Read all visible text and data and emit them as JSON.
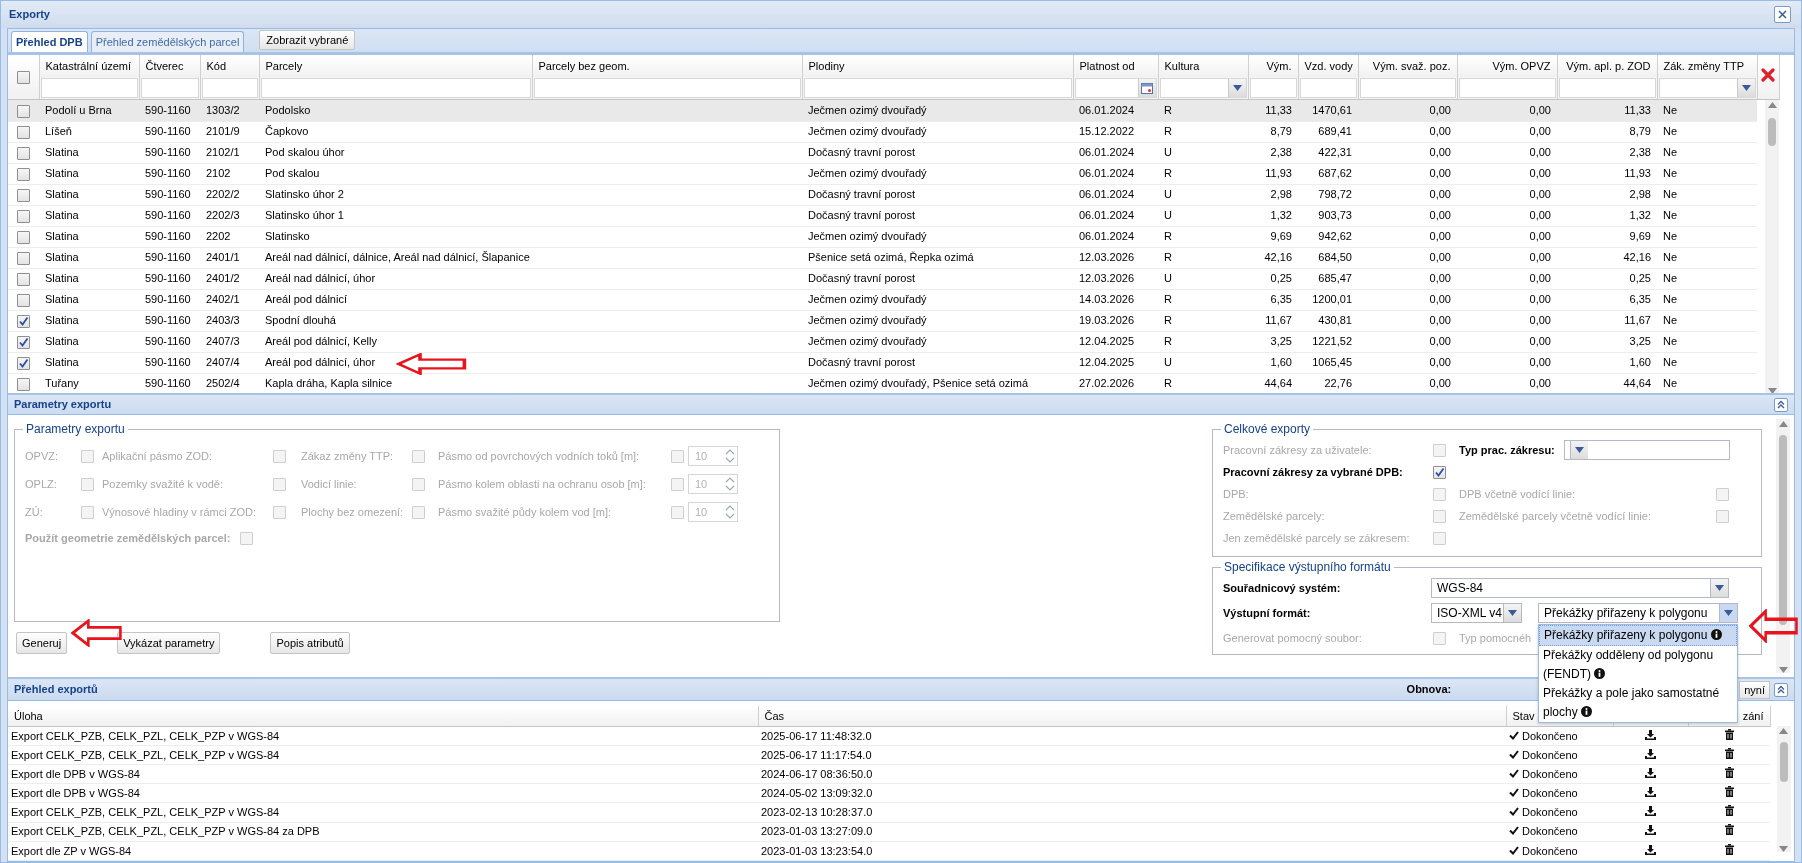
{
  "window": {
    "title": "Exporty"
  },
  "tabs": [
    {
      "label": "Přehled DPB",
      "selected": true
    },
    {
      "label": "Přehled zemědělských parcel",
      "selected": false
    }
  ],
  "show_selected_button": "Zobrazit vybrané",
  "parcels_grid": {
    "select_all": {
      "checked": false
    },
    "columns": [
      {
        "label": "Katastrální území",
        "kind": "text"
      },
      {
        "label": "Čtverec",
        "kind": "text"
      },
      {
        "label": "Kód",
        "kind": "text"
      },
      {
        "label": "Parcely",
        "kind": "text"
      },
      {
        "label": "Parcely bez geom.",
        "kind": "text"
      },
      {
        "label": "Plodiny",
        "kind": "text"
      },
      {
        "label": "Platnost od",
        "kind": "date"
      },
      {
        "label": "Kultura",
        "kind": "select"
      },
      {
        "label": "Vým.",
        "kind": "number"
      },
      {
        "label": "Vzd. vody",
        "kind": "number"
      },
      {
        "label": "Vým. svaž. poz.",
        "kind": "number"
      },
      {
        "label": "Vým. OPVZ",
        "kind": "number"
      },
      {
        "label": "Vým. apl. p. ZOD",
        "kind": "number"
      },
      {
        "label": "Zák. změny TTP",
        "kind": "select"
      }
    ],
    "rows": [
      {
        "selected": true,
        "checked": false,
        "cells": [
          "Podolí u Brna",
          "590-1160",
          "1303/2",
          "Podolsko",
          "",
          "Ječmen ozimý dvouřadý",
          "06.01.2024",
          "R",
          "11,33",
          "1470,61",
          "0,00",
          "0,00",
          "11,33",
          "Ne"
        ]
      },
      {
        "selected": false,
        "checked": false,
        "cells": [
          "Líšeň",
          "590-1160",
          "2101/9",
          "Čapkovo",
          "",
          "Ječmen ozimý dvouřadý",
          "15.12.2022",
          "R",
          "8,79",
          "689,41",
          "0,00",
          "0,00",
          "8,79",
          "Ne"
        ]
      },
      {
        "selected": false,
        "checked": false,
        "cells": [
          "Slatina",
          "590-1160",
          "2102/1",
          "Pod skalou úhor",
          "",
          "Dočasný travní porost",
          "06.01.2024",
          "U",
          "2,38",
          "422,31",
          "0,00",
          "0,00",
          "2,38",
          "Ne"
        ]
      },
      {
        "selected": false,
        "checked": false,
        "cells": [
          "Slatina",
          "590-1160",
          "2102",
          "Pod skalou",
          "",
          "Ječmen ozimý dvouřadý",
          "06.01.2024",
          "R",
          "11,93",
          "687,62",
          "0,00",
          "0,00",
          "11,93",
          "Ne"
        ]
      },
      {
        "selected": false,
        "checked": false,
        "cells": [
          "Slatina",
          "590-1160",
          "2202/2",
          "Slatinsko úhor 2",
          "",
          "Dočasný travní porost",
          "06.01.2024",
          "U",
          "2,98",
          "798,72",
          "0,00",
          "0,00",
          "2,98",
          "Ne"
        ]
      },
      {
        "selected": false,
        "checked": false,
        "cells": [
          "Slatina",
          "590-1160",
          "2202/3",
          "Slatinsko úhor 1",
          "",
          "Dočasný travní porost",
          "06.01.2024",
          "U",
          "1,32",
          "903,73",
          "0,00",
          "0,00",
          "1,32",
          "Ne"
        ]
      },
      {
        "selected": false,
        "checked": false,
        "cells": [
          "Slatina",
          "590-1160",
          "2202",
          "Slatinsko",
          "",
          "Ječmen ozimý dvouřadý",
          "06.01.2024",
          "R",
          "9,69",
          "942,62",
          "0,00",
          "0,00",
          "9,69",
          "Ne"
        ]
      },
      {
        "selected": false,
        "checked": false,
        "cells": [
          "Slatina",
          "590-1160",
          "2401/1",
          "Areál nad dálnicí, dálnice, Areál nad dálnicí, Šlapanice",
          "",
          "Pšenice setá ozimá, Řepka ozimá",
          "12.03.2026",
          "R",
          "42,16",
          "684,50",
          "0,00",
          "0,00",
          "42,16",
          "Ne"
        ]
      },
      {
        "selected": false,
        "checked": false,
        "cells": [
          "Slatina",
          "590-1160",
          "2401/2",
          "Areál nad dálnicí, úhor",
          "",
          "Dočasný travní porost",
          "12.03.2026",
          "U",
          "0,25",
          "685,47",
          "0,00",
          "0,00",
          "0,25",
          "Ne"
        ]
      },
      {
        "selected": false,
        "checked": false,
        "cells": [
          "Slatina",
          "590-1160",
          "2402/1",
          "Areál pod dálnicí",
          "",
          "Ječmen ozimý dvouřadý",
          "14.03.2026",
          "R",
          "6,35",
          "1200,01",
          "0,00",
          "0,00",
          "6,35",
          "Ne"
        ]
      },
      {
        "selected": false,
        "checked": true,
        "cells": [
          "Slatina",
          "590-1160",
          "2403/3",
          "Spodní dlouhá",
          "",
          "Ječmen ozimý dvouřadý",
          "19.03.2026",
          "R",
          "11,67",
          "430,81",
          "0,00",
          "0,00",
          "11,67",
          "Ne"
        ]
      },
      {
        "selected": false,
        "checked": true,
        "cells": [
          "Slatina",
          "590-1160",
          "2407/3",
          "Areál pod dálnicí, Kelly",
          "",
          "Ječmen ozimý dvouřadý",
          "12.04.2025",
          "R",
          "3,25",
          "1221,52",
          "0,00",
          "0,00",
          "3,25",
          "Ne"
        ]
      },
      {
        "selected": false,
        "checked": true,
        "cells": [
          "Slatina",
          "590-1160",
          "2407/4",
          "Areál pod dálnicí, úhor",
          "",
          "Dočasný travní porost",
          "12.04.2025",
          "U",
          "1,60",
          "1065,45",
          "0,00",
          "0,00",
          "1,60",
          "Ne"
        ]
      },
      {
        "selected": false,
        "checked": false,
        "cells": [
          "Tuřany",
          "590-1160",
          "2502/4",
          "Kapla dráha, Kapla silnice",
          "",
          "Ječmen ozimý dvouřadý, Pšenice setá ozimá",
          "27.02.2026",
          "R",
          "44,64",
          "22,76",
          "0,00",
          "0,00",
          "44,64",
          "Ne"
        ]
      }
    ]
  },
  "export_params": {
    "title": "Parametry exportu",
    "legend": "Parametry exportu",
    "rows": [
      [
        {
          "label": "OPVZ:",
          "checked": false,
          "disabled": true
        },
        {
          "label": "Aplikační pásmo ZOD:",
          "checked": false,
          "disabled": true
        },
        {
          "label": "Zákaz změny TTP:",
          "checked": false,
          "disabled": true
        },
        {
          "label": "Pásmo od povrchových vodních toků [m]:",
          "checked": false,
          "disabled": true,
          "value": "10"
        }
      ],
      [
        {
          "label": "OPLZ:",
          "checked": false,
          "disabled": true
        },
        {
          "label": "Pozemky svažité k vodě:",
          "checked": false,
          "disabled": true
        },
        {
          "label": "Vodicí linie:",
          "checked": false,
          "disabled": true
        },
        {
          "label": "Pásmo kolem oblasti na ochranu osob [m]:",
          "checked": false,
          "disabled": true,
          "value": "10"
        }
      ],
      [
        {
          "label": "ZÚ:",
          "checked": false,
          "disabled": true
        },
        {
          "label": "Výnosové hladiny v rámci ZOD:",
          "checked": false,
          "disabled": true
        },
        {
          "label": "Plochy bez omezení:",
          "checked": false,
          "disabled": true
        },
        {
          "label": "Pásmo svažité půdy kolem vod [m]:",
          "checked": false,
          "disabled": true,
          "value": "10"
        }
      ]
    ],
    "geometry": {
      "label": "Použít geometrie zemědělských parcel:",
      "checked": false,
      "disabled": true
    },
    "buttons": [
      "Generuj",
      "Vykázat parametry",
      "Popis atributů"
    ]
  },
  "total_exports": {
    "legend": "Celkové exporty",
    "rows": [
      [
        {
          "kind": "checkbox",
          "label": "Pracovní zákresy za uživatele:",
          "checked": false,
          "disabled": true
        },
        {
          "kind": "select",
          "label": "Typ prac. zákresu:",
          "disabled": false
        }
      ],
      [
        {
          "kind": "checkbox",
          "label": "Pracovní zákresy za vybrané DPB:",
          "checked": true,
          "disabled": false
        }
      ],
      [
        {
          "kind": "checkbox",
          "label": "DPB:",
          "checked": false,
          "disabled": true
        },
        {
          "kind": "checkbox",
          "label": "DPB včetně vodící linie:",
          "checked": false,
          "disabled": true
        }
      ],
      [
        {
          "kind": "checkbox",
          "label": "Zemědělské parcely:",
          "checked": false,
          "disabled": true
        },
        {
          "kind": "checkbox",
          "label": "Zemědělské parcely včetně vodící linie:",
          "checked": false,
          "disabled": true
        }
      ],
      [
        {
          "kind": "checkbox",
          "label": "Jen zemědělské parcely se zákresem:",
          "checked": false,
          "disabled": true
        }
      ]
    ]
  },
  "format_spec": {
    "legend": "Specifikace výstupního formátu",
    "coordinate_system": {
      "label": "Souřadnicový systém:",
      "value": "WGS-84"
    },
    "output_format": {
      "label": "Výstupní formát:",
      "value": "ISO-XML v4",
      "variant": {
        "value": "Překážky přiřazeny k polygonu",
        "expanded": true,
        "options": [
          {
            "label": "Překážky přiřazeny k polygonu",
            "selected": true
          },
          {
            "label": "Překážky odděleny od polygonu (FENDT)",
            "selected": false
          },
          {
            "label": "Překážky a pole jako samostatné plochy",
            "selected": false
          }
        ]
      }
    },
    "helper_file": {
      "label": "Generovat pomocný soubor:",
      "checked": false,
      "disabled": true
    },
    "helper_type": {
      "label": "Typ pomocnéh",
      "disabled": true
    }
  },
  "exports": {
    "title": "Přehled exportů",
    "refresh_label": "Obnova:",
    "refresh_button": "nyní",
    "columns": [
      "Úloha",
      "Čas",
      "Stav",
      "zání"
    ],
    "rows": [
      {
        "task": "Export CELK_PZB, CELK_PZL, CELK_PZP v WGS-84",
        "time": "2025-06-17 11:48:32.0",
        "status": "Dokončeno",
        "done": true
      },
      {
        "task": "Export CELK_PZB, CELK_PZL, CELK_PZP v WGS-84",
        "time": "2025-06-17 11:17:54.0",
        "status": "Dokončeno",
        "done": true
      },
      {
        "task": "Export dle DPB v WGS-84",
        "time": "2024-06-17 08:36:50.0",
        "status": "Dokončeno",
        "done": true
      },
      {
        "task": "Export dle DPB v WGS-84",
        "time": "2024-05-02 13:09:32.0",
        "status": "Dokončeno",
        "done": true
      },
      {
        "task": "Export CELK_PZB, CELK_PZL, CELK_PZP v WGS-84",
        "time": "2023-02-13 10:28:37.0",
        "status": "Dokončeno",
        "done": true
      },
      {
        "task": "Export CELK_PZB, CELK_PZL, CELK_PZP v WGS-84 za DPB",
        "time": "2023-01-03 13:27:09.0",
        "status": "Dokončeno",
        "done": true
      },
      {
        "task": "Export dle ZP v WGS-84",
        "time": "2023-01-03 13:23:54.0",
        "status": "Dokončeno",
        "done": true
      }
    ]
  }
}
